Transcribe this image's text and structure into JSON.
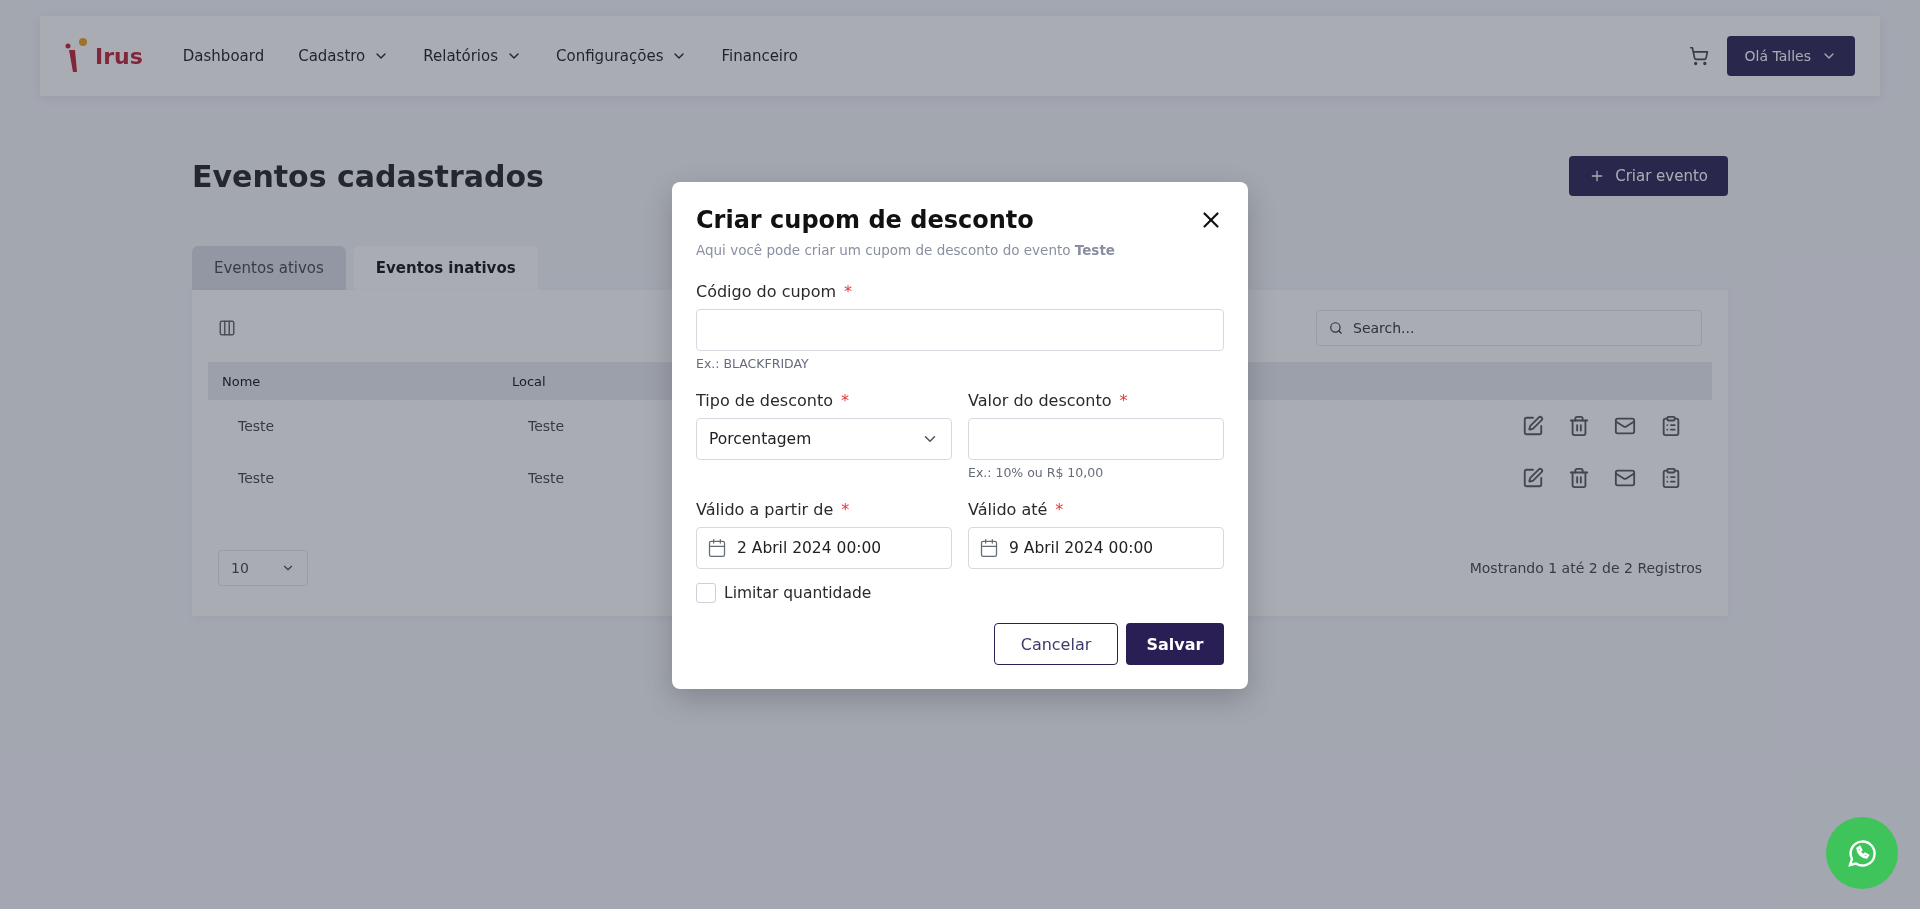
{
  "header": {
    "logo_text": "Irus",
    "nav": [
      {
        "label": "Dashboard",
        "dropdown": false
      },
      {
        "label": "Cadastro",
        "dropdown": true
      },
      {
        "label": "Relatórios",
        "dropdown": true
      },
      {
        "label": "Configurações",
        "dropdown": true
      },
      {
        "label": "Financeiro",
        "dropdown": false
      }
    ],
    "user_button": "Olá Talles"
  },
  "page": {
    "title": "Eventos cadastrados",
    "create_button": "Criar evento",
    "tabs": [
      {
        "label": "Eventos ativos",
        "selected": false
      },
      {
        "label": "Eventos inativos",
        "selected": true
      }
    ],
    "search": {
      "placeholder": "Search..."
    },
    "columns": [
      "Nome",
      "Local"
    ],
    "rows": [
      {
        "name": "Teste",
        "local": "Teste"
      },
      {
        "name": "Teste",
        "local": "Teste"
      }
    ],
    "page_size": "10",
    "summary": "Mostrando 1 até 2 de 2 Registros"
  },
  "modal": {
    "title": "Criar cupom de desconto",
    "subtitle": "Aqui você pode criar um cupom de desconto do evento **Teste**",
    "field_rows": [
      [
        {
          "kind": "text",
          "label": "Código do cupom",
          "required_mark": "*",
          "hint": "Ex.: BLACKFRIDAY"
        }
      ],
      [
        {
          "kind": "select",
          "label": "Tipo de desconto",
          "required_mark": "*",
          "value": "Porcentagem"
        },
        {
          "kind": "text",
          "label": "Valor do desconto",
          "required_mark": "*",
          "hint": "Ex.: 10% ou R$ 10,00"
        }
      ],
      [
        {
          "kind": "date",
          "label": "Válido a partir de",
          "required_mark": "*",
          "value": "2 Abril 2024 00:00"
        },
        {
          "kind": "date",
          "label": "Válido até",
          "required_mark": "*",
          "value": "9 Abril 2024 00:00"
        }
      ]
    ],
    "checkbox": {
      "label": "Limitar quantidade",
      "checked": false
    },
    "cancel_button": "Cancelar",
    "save_button": "Salvar"
  }
}
